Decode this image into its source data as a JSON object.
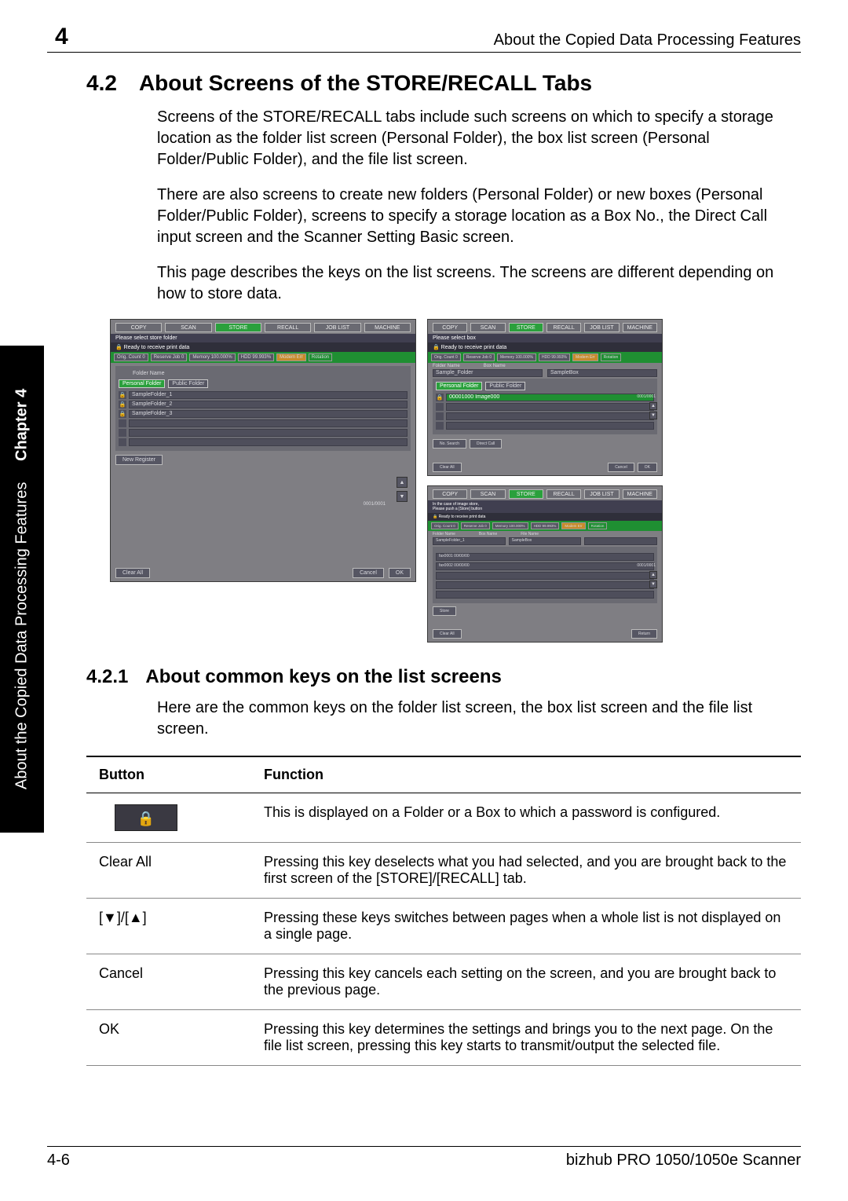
{
  "chapter_number_badge": "4",
  "running_head": "About the Copied Data Processing Features",
  "side_tab": {
    "text": "About the Copied Data Processing Features",
    "chapter": "Chapter 4"
  },
  "section": {
    "num": "4.2",
    "title": "About Screens of the STORE/RECALL Tabs"
  },
  "paras": [
    "Screens of the STORE/RECALL tabs include such screens on which to specify a storage location as the folder list screen (Personal Folder), the box list screen (Personal Folder/Public Folder), and the file list screen.",
    "There are also screens to create new folders (Personal Folder) or new boxes (Personal Folder/Public Folder), screens to specify a storage location as a Box No., the Direct Call input screen and the Scanner Setting Basic screen.",
    "This page describes the keys on the list screens. The screens are different depending on how to store data."
  ],
  "screenshot1": {
    "tabs": [
      "COPY",
      "SCAN",
      "STORE",
      "RECALL",
      "JOB LIST",
      "MACHINE"
    ],
    "active_tab": 2,
    "title_bar": "Please select store folder",
    "ready": "Ready to receive print data",
    "status_chips": [
      "Orig. Count   0",
      "Reserve Job   0",
      "Memory 100.000%",
      "HDD  99.993%",
      "Modem Err",
      "Rotation"
    ],
    "panel_label": "Folder Name",
    "subtabs": [
      "Personal Folder",
      "Public Folder"
    ],
    "rows": [
      "SampleFolder_1",
      "SampleFolder_2",
      "SampleFolder_3"
    ],
    "count": "0001/0001",
    "new_register": "New Register",
    "footer": [
      "Clear All",
      "Cancel",
      "OK"
    ]
  },
  "screenshot2": {
    "tabs": [
      "COPY",
      "SCAN",
      "STORE",
      "RECALL",
      "JOB LIST",
      "MACHINE"
    ],
    "active_tab": 2,
    "title_bar": "Please select box",
    "ready": "Ready to receive print data",
    "status_chips": [
      "Orig. Count  0",
      "Reserve Job  0",
      "Memory 100.000%",
      "HDD  99.993%",
      "Modem Err",
      "Rotation"
    ],
    "headers": [
      "Folder Name",
      "Box Name"
    ],
    "subtabs": [
      "Personal Folder",
      "Public Folder"
    ],
    "label_no_name": [
      "Sample_Folder",
      "SampleBox"
    ],
    "rows": [
      "00001000  Image000"
    ],
    "count": "0001/0001",
    "footer_left": [
      "No. Search",
      "Direct Call"
    ],
    "footer": [
      "Clear All",
      "Cancel",
      "OK"
    ]
  },
  "screenshot3": {
    "tabs": [
      "COPY",
      "SCAN",
      "STORE",
      "RECALL",
      "JOB LIST",
      "MACHINE"
    ],
    "active_tab": 2,
    "title_bar1": "In the case of image store,",
    "title_bar2": "Please push a [Store] button",
    "ready": "Ready to receive print data",
    "status_chips": [
      "Orig. Count 0",
      "Reserve Job 0",
      "Memory 100.000%",
      "HDD  99.993%",
      "Modem Err",
      "Rotation"
    ],
    "headers": [
      "Folder Name",
      "Box Name",
      "File Name"
    ],
    "names": [
      "SampleFolder_1",
      "SampleBox"
    ],
    "rows": [
      "fax0001    00/00/00",
      "fax0002    00/00/00"
    ],
    "count": "0001/0001",
    "store": "Store",
    "footer": [
      "Clear All",
      "Return"
    ]
  },
  "subsection": {
    "num": "4.2.1",
    "title": "About common keys on the list screens"
  },
  "sub_para": "Here are the common keys on the folder list screen, the box list screen and the file list screen.",
  "table": {
    "head": [
      "Button",
      "Function"
    ],
    "rows": [
      {
        "btn_type": "lock",
        "btn": "🔒",
        "fn": "This is displayed on a Folder or a Box to which a password is configured."
      },
      {
        "btn": "Clear All",
        "fn": "Pressing this key deselects what you had selected, and you are brought back to the first screen of the [STORE]/[RECALL] tab."
      },
      {
        "btn": "[▼]/[▲]",
        "fn": "Pressing these keys switches between pages when a whole list is not displayed on a single page."
      },
      {
        "btn": "Cancel",
        "fn": "Pressing this key cancels each setting on the screen, and you are brought back to the previous page."
      },
      {
        "btn": "OK",
        "fn": "Pressing this key determines the settings and brings you to the next page. On the file list screen, pressing this key starts to transmit/output the selected file."
      }
    ]
  },
  "footer": {
    "left": "4-6",
    "right": "bizhub PRO 1050/1050e Scanner"
  }
}
